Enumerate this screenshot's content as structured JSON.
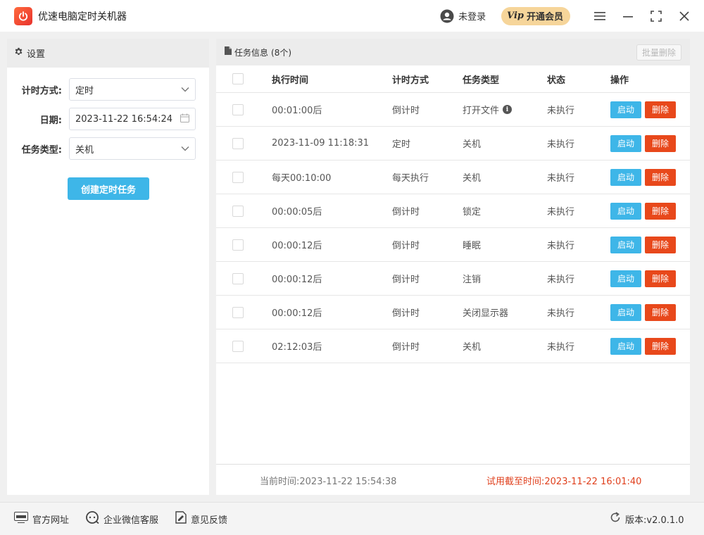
{
  "app": {
    "title": "优速电脑定时关机器"
  },
  "header": {
    "user_label": "未登录",
    "vip_badge": "Vip",
    "vip_label": "开通会员"
  },
  "settings": {
    "panel_title": "设置",
    "mode_label": "计时方式:",
    "mode_value": "定时",
    "date_label": "日期:",
    "date_value": "2023-11-22 16:54:24",
    "type_label": "任务类型:",
    "type_value": "关机",
    "create_button": "创建定时任务"
  },
  "tasks": {
    "panel_title": "任务信息",
    "count_label": "(8个)",
    "batch_delete": "批量删除",
    "columns": [
      "执行时间",
      "计时方式",
      "任务类型",
      "状态",
      "操作"
    ],
    "start_label": "启动",
    "delete_label": "删除",
    "rows": [
      {
        "time": "00:01:00后",
        "mode": "倒计时",
        "type": "打开文件",
        "state": "未执行",
        "info": "i"
      },
      {
        "time": "2023-11-09 11:18:31",
        "mode": "定时",
        "type": "关机",
        "state": "未执行"
      },
      {
        "time": "每天00:10:00",
        "mode": "每天执行",
        "type": "关机",
        "state": "未执行"
      },
      {
        "time": "00:00:05后",
        "mode": "倒计时",
        "type": "锁定",
        "state": "未执行"
      },
      {
        "time": "00:00:12后",
        "mode": "倒计时",
        "type": "睡眠",
        "state": "未执行"
      },
      {
        "time": "00:00:12后",
        "mode": "倒计时",
        "type": "注销",
        "state": "未执行"
      },
      {
        "time": "00:00:12后",
        "mode": "倒计时",
        "type": "关闭显示器",
        "state": "未执行"
      },
      {
        "time": "02:12:03后",
        "mode": "倒计时",
        "type": "关机",
        "state": "未执行"
      }
    ]
  },
  "footer": {
    "current_time": "当前时间:2023-11-22 15:54:38",
    "trial_time": "试用截至时间:2023-11-22 16:01:40"
  },
  "bottombar": {
    "website": "官方网址",
    "wechat": "企业微信客服",
    "feedback": "意见反馈",
    "version": "版本:v2.0.1.0"
  },
  "icons": {
    "logo": "power-icon",
    "user": "user-icon",
    "menu": "menu-icon",
    "minimize": "minimize-icon",
    "maximize": "maximize-icon",
    "close": "close-icon",
    "settings": "gear-icon",
    "tasks": "document-icon",
    "calendar": "calendar-icon",
    "dropdown": "chevron-down-icon",
    "info": "info-icon",
    "website": "website-icon",
    "wechat": "chat-icon",
    "feedback": "feedback-icon",
    "version": "refresh-icon"
  },
  "colors": {
    "primary": "#3eb6e8",
    "danger": "#e8481b",
    "vip": "#f6d59a",
    "trial": "#e0401d"
  }
}
